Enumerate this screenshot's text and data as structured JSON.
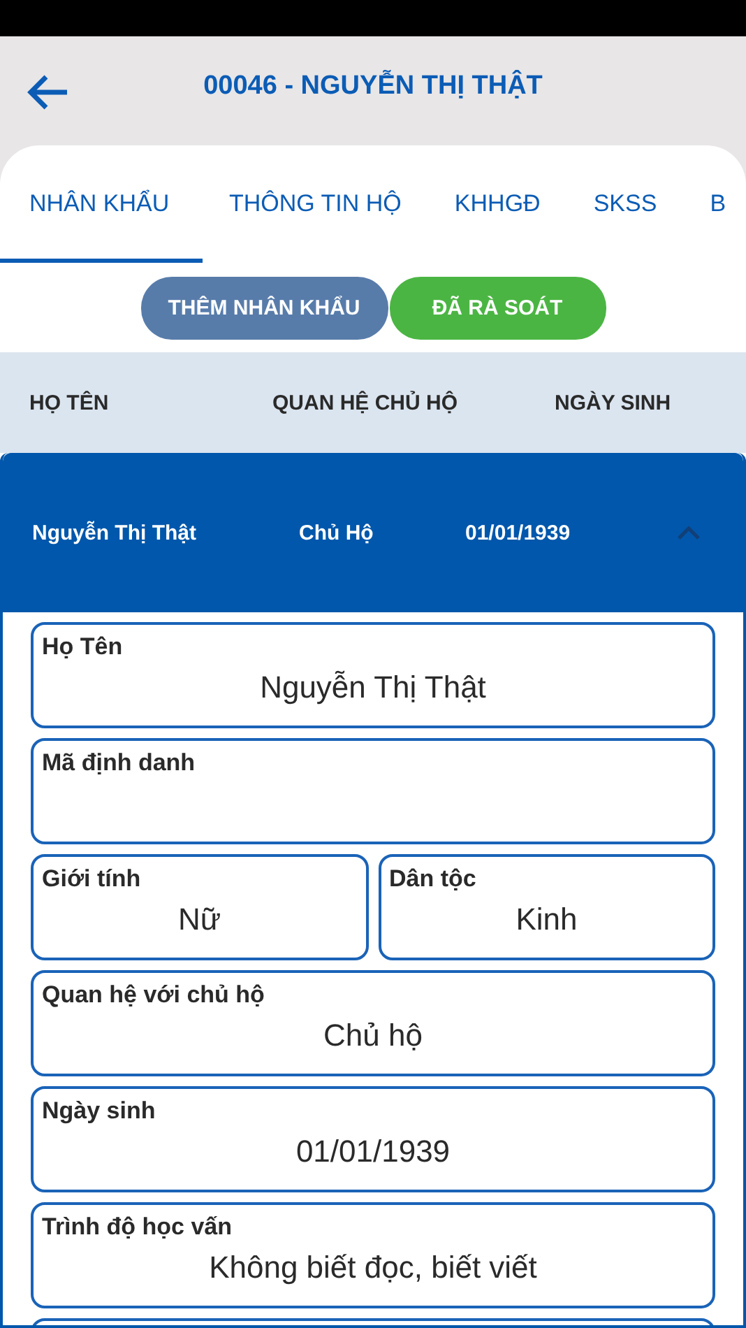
{
  "header": {
    "title": "00046 - NGUYỄN THỊ THẬT"
  },
  "tabs": [
    {
      "label": "NHÂN KHẨU",
      "selected": true
    },
    {
      "label": "THÔNG TIN HỘ",
      "selected": false
    },
    {
      "label": "KHHGĐ",
      "selected": false
    },
    {
      "label": "SKSS",
      "selected": false
    },
    {
      "label": "B",
      "selected": false
    }
  ],
  "buttons": [
    {
      "label": "THÊM NHÂN KHẨU",
      "kind": "add"
    },
    {
      "label": "ĐÃ RÀ SOÁT",
      "kind": "done"
    }
  ],
  "table": {
    "columns": [
      "HỌ TÊN",
      "QUAN HỆ CHỦ HỘ",
      "NGÀY SINH"
    ],
    "rows": [
      {
        "cells": [
          "Nguyễn Thị Thật",
          "Chủ Hộ",
          "01/01/1939"
        ],
        "expanded": true
      }
    ]
  },
  "form": {
    "rows": [
      [
        {
          "label": "Họ Tên",
          "value": "Nguyễn Thị Thật"
        }
      ],
      [
        {
          "label": "Mã định danh"
        }
      ],
      [
        {
          "label": "Giới tính",
          "value": "Nữ"
        },
        {
          "label": "Dân tộc",
          "value": "Kinh"
        }
      ],
      [
        {
          "label": "Quan hệ với chủ hộ",
          "value": "Chủ hộ"
        }
      ],
      [
        {
          "label": "Ngày sinh",
          "value": "01/01/1939"
        }
      ],
      [
        {
          "label": "Trình độ học vấn",
          "value": "Không biết đọc, biết viết"
        }
      ]
    ]
  }
}
